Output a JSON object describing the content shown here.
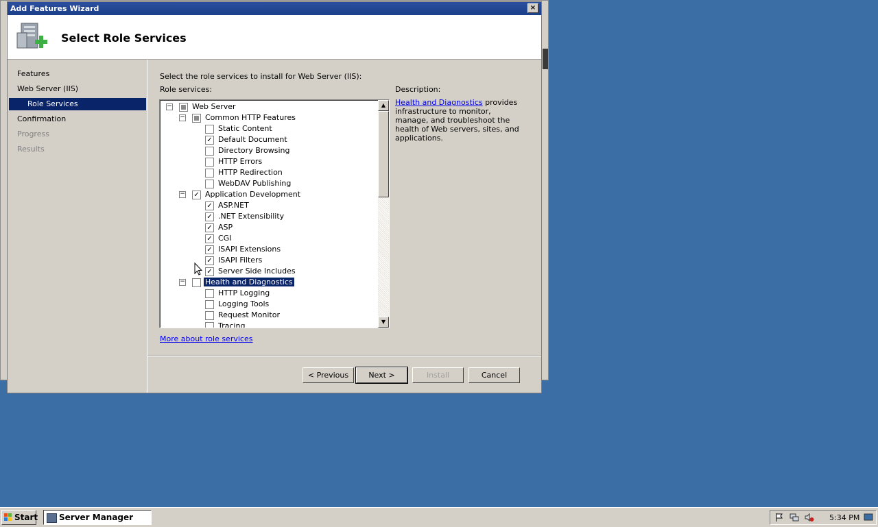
{
  "wizard": {
    "title": "Add Features Wizard",
    "header_title": "Select Role Services",
    "close_glyph": "×"
  },
  "nav": {
    "items": [
      {
        "label": "Features",
        "state": "normal"
      },
      {
        "label": "Web Server (IIS)",
        "state": "normal"
      },
      {
        "label": "Role Services",
        "state": "selected"
      },
      {
        "label": "Confirmation",
        "state": "normal"
      },
      {
        "label": "Progress",
        "state": "disabled"
      },
      {
        "label": "Results",
        "state": "disabled"
      }
    ]
  },
  "main": {
    "instruction": "Select the role services to install for Web Server (IIS):",
    "role_services_label": "Role services:",
    "description_label": "Description:",
    "description_link": "Health and Diagnostics",
    "description_text": " provides infrastructure to monitor, manage, and troubleshoot the health of Web servers, sites, and applications.",
    "more_link": "More about role services"
  },
  "tree": [
    {
      "label": "Web Server",
      "level": 0,
      "expander": "−",
      "check": "partial"
    },
    {
      "label": "Common HTTP Features",
      "level": 1,
      "expander": "−",
      "check": "partial"
    },
    {
      "label": "Static Content",
      "level": 2,
      "check": "unchecked"
    },
    {
      "label": "Default Document",
      "level": 2,
      "check": "checked"
    },
    {
      "label": "Directory Browsing",
      "level": 2,
      "check": "unchecked"
    },
    {
      "label": "HTTP Errors",
      "level": 2,
      "check": "unchecked"
    },
    {
      "label": "HTTP Redirection",
      "level": 2,
      "check": "unchecked"
    },
    {
      "label": "WebDAV Publishing",
      "level": 2,
      "check": "unchecked"
    },
    {
      "label": "Application Development",
      "level": 1,
      "expander": "−",
      "check": "checked"
    },
    {
      "label": "ASP.NET",
      "level": 2,
      "check": "checked"
    },
    {
      "label": ".NET Extensibility",
      "level": 2,
      "check": "checked"
    },
    {
      "label": "ASP",
      "level": 2,
      "check": "checked"
    },
    {
      "label": "CGI",
      "level": 2,
      "check": "checked"
    },
    {
      "label": "ISAPI Extensions",
      "level": 2,
      "check": "checked"
    },
    {
      "label": "ISAPI Filters",
      "level": 2,
      "check": "checked"
    },
    {
      "label": "Server Side Includes",
      "level": 2,
      "check": "checked"
    },
    {
      "label": "Health and Diagnostics",
      "level": 1,
      "expander": "−",
      "check": "unchecked",
      "selected": true
    },
    {
      "label": "HTTP Logging",
      "level": 2,
      "check": "unchecked"
    },
    {
      "label": "Logging Tools",
      "level": 2,
      "check": "unchecked"
    },
    {
      "label": "Request Monitor",
      "level": 2,
      "check": "unchecked"
    },
    {
      "label": "Tracing",
      "level": 2,
      "check": "unchecked"
    }
  ],
  "buttons": {
    "previous": "< Previous",
    "next": "Next >",
    "install": "Install",
    "cancel": "Cancel"
  },
  "taskbar": {
    "start": "Start",
    "task": "Server Manager",
    "clock": "5:34 PM"
  },
  "icons": {
    "check_glyph": "✓",
    "scroll_up": "▲",
    "scroll_down": "▼"
  },
  "colors": {
    "desktop": "#3a6ea5",
    "selection": "#0a246a",
    "titlebar": "#1c3f8a",
    "link": "#0000ee"
  }
}
